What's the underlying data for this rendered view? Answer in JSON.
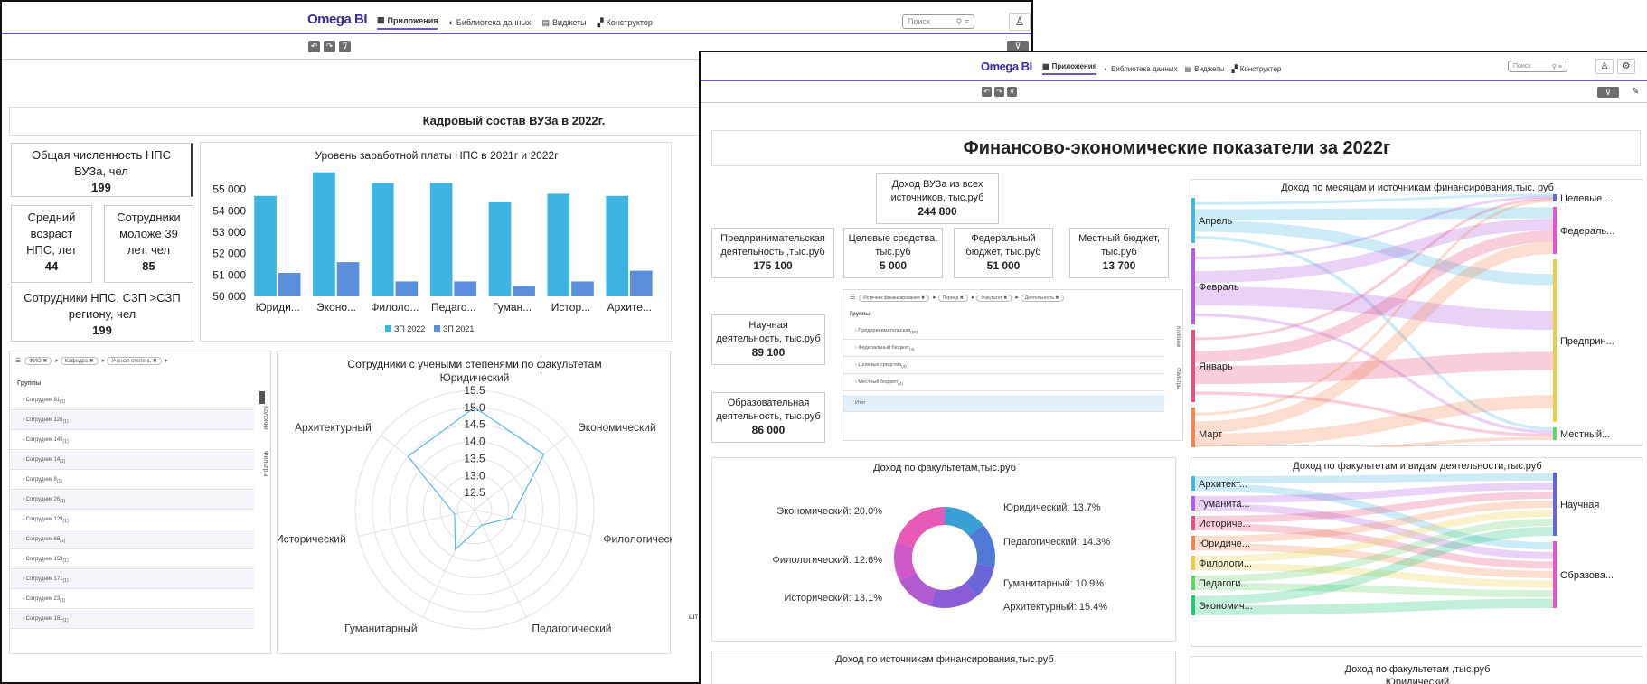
{
  "w1": {
    "logo": "Omega BI",
    "nav": [
      "Приложения",
      "Библиотека данных",
      "Виджеты",
      "Конструктор"
    ],
    "search_placeholder": "Поиск",
    "title": "Кадровый состав ВУЗа в 2022г.",
    "cards": {
      "total_label": "Общая численность НПС ВУЗа, чел",
      "total_value": "199",
      "age_label": "Средний возраст НПС, лет",
      "age_value": "44",
      "young_label": "Сотрудники моложе 39 лет, чел",
      "young_value": "85",
      "salary_label": "Сотрудники НПС, СЗП >СЗП региону, чел",
      "salary_value": "199"
    },
    "table": {
      "chips": [
        "ФИО",
        "Кафедра",
        "Ученая степень"
      ],
      "header": "Группы",
      "rows": [
        "Сотрудник 81",
        "Сотрудник 126",
        "Сотрудник 149",
        "Сотрудник 14",
        "Сотрудник 8",
        "Сотрудник 26",
        "Сотрудник 129",
        "Сотрудник 68",
        "Сотрудник 159",
        "Сотрудник 171",
        "Сотрудник 23",
        "Сотрудник 181"
      ],
      "row_count_suffix": "(1)",
      "side1": "Колонки",
      "side2": "Фильтры"
    },
    "cut_text": "шт"
  },
  "w2": {
    "logo": "Omega BI",
    "nav": [
      "Приложения",
      "Библиотека данных",
      "Виджеты",
      "Конструктор"
    ],
    "search_placeholder": "Поиск",
    "title": "Финансово-экономические показатели за 2022г",
    "cards": {
      "income_label": "Доход ВУЗа из всех источников, тыс.руб",
      "income_value": "244 800",
      "biz_label": "Предпринимательская деятельность ,тыс.руб",
      "biz_value": "175 100",
      "target_label": "Целевые средства, тыс.руб",
      "target_value": "5 000",
      "fed_label": "Федеральный бюджет, тыс.руб",
      "fed_value": "51 000",
      "local_label": "Местный бюджет, тыс.руб",
      "local_value": "13 700",
      "sci_label": "Научная деятельность, тыс.руб",
      "sci_value": "89 100",
      "edu_label": "Образовательная деятельность, тыс.руб",
      "edu_value": "86 000"
    },
    "table": {
      "chips": [
        "Источник финансирования",
        "Период",
        "Факультет",
        "Деятельность"
      ],
      "header": "Группы",
      "rows": [
        {
          "label": "Предпринимательская",
          "count": "(56)"
        },
        {
          "label": "Федеральный бюджет",
          "count": "(4)"
        },
        {
          "label": "Целевые средства",
          "count": "(4)"
        },
        {
          "label": "Местный бюджет",
          "count": "(4)"
        }
      ],
      "total": "Итог",
      "side1": "Колонки",
      "side2": "Фильтры"
    },
    "sankey1": {
      "title": "Доход по месяцам и источникам финансирования,тыс. руб",
      "left": [
        "Апрель",
        "Февраль",
        "Январь",
        "Март"
      ],
      "right": [
        "Целевые ...",
        "Федераль...",
        "Предприн...",
        "Местный..."
      ]
    },
    "sankey2": {
      "title": "Доход по факультетам и видам деятельности,тыс.руб",
      "left": [
        "Архитект...",
        "Гуманита...",
        "Историче...",
        "Юридиче...",
        "Филологи...",
        "Педагоги...",
        "Экономич..."
      ],
      "right": [
        "Научная",
        "Образова..."
      ]
    },
    "bottom1_title": "Доход по источникам финансирования,тыс.руб",
    "bottom2_title": "Доход по факультетам ,тыс.руб",
    "bottom2_sub": "Юридический"
  },
  "colors": {
    "accent": "#6c58c8",
    "bar2022": "#3db5e0",
    "bar2021": "#5b8fde"
  },
  "chart_data": [
    {
      "type": "bar",
      "title": "Уровень заработной платы НПС в 2021г и 2022г",
      "categories": [
        "Юриди...",
        "Эконо...",
        "Филоло...",
        "Педаго...",
        "Гуман...",
        "Истор...",
        "Архите..."
      ],
      "series": [
        {
          "name": "ЗП 2022",
          "values": [
            54700,
            55800,
            55300,
            55300,
            54400,
            54800,
            54700
          ]
        },
        {
          "name": "ЗП 2021",
          "values": [
            51100,
            51600,
            50700,
            50700,
            50500,
            50700,
            51200
          ]
        }
      ],
      "ylim": [
        50000,
        56000
      ],
      "yticks": [
        "50 000",
        "51 000",
        "52 000",
        "53 000",
        "54 000",
        "55 000"
      ],
      "legend": "bottom"
    },
    {
      "type": "radar",
      "title": "Сотрудники с учеными степенями по факультетам",
      "categories": [
        "Юридический",
        "Экономический",
        "Филологический",
        "Педагогический",
        "Гуманитарный",
        "Исторический",
        "Архитектурный"
      ],
      "values": [
        15.0,
        14.6,
        13.1,
        12.5,
        13.3,
        12.6,
        14.5
      ],
      "ticks": [
        "12.5",
        "13.0",
        "13.5",
        "14.0",
        "14.5",
        "15.0",
        "15.5"
      ],
      "rmin": 12,
      "rmax": 15.5
    },
    {
      "type": "pie",
      "title": "Доход по факультетам,тыс.руб",
      "slices": [
        {
          "label": "Юридический",
          "pct": 13.7,
          "color": "#3a9fd4"
        },
        {
          "label": "Педагогический",
          "pct": 14.3,
          "color": "#4f7ad6"
        },
        {
          "label": "Гуманитарный",
          "pct": 10.9,
          "color": "#6b66d8"
        },
        {
          "label": "Архитектурный",
          "pct": 15.4,
          "color": "#8a5cd6"
        },
        {
          "label": "Исторический",
          "pct": 13.1,
          "color": "#b05bd0"
        },
        {
          "label": "Филологический",
          "pct": 12.6,
          "color": "#cf58c8"
        },
        {
          "label": "Экономический",
          "pct": 20.0,
          "color": "#e55ab5"
        }
      ],
      "label_texts": [
        "Юридический: 13.7%",
        "Педагогический: 14.3%",
        "Гуманитарный: 10.9%",
        "Архитектурный: 15.4%",
        "Исторический: 13.1%",
        "Филологический: 12.6%",
        "Экономический: 20.0%"
      ]
    }
  ]
}
